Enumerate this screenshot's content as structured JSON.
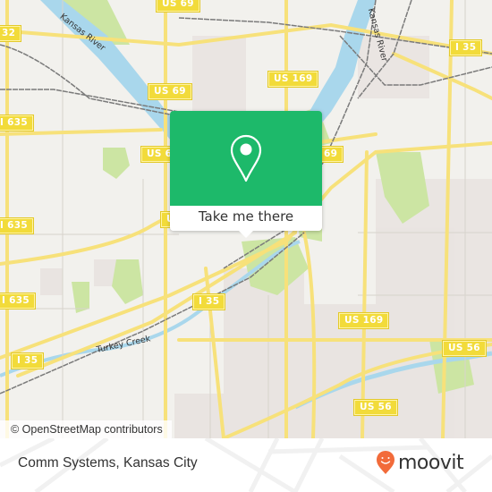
{
  "map": {
    "region": "Kansas City",
    "colors": {
      "background": "#f2f1ed",
      "water": "#a9d7ec",
      "park": "#cce5a3",
      "road": "#f7e17a",
      "rail": "#7a7a7a",
      "shield": "#f2db3a",
      "residential": "#e9e3e0"
    },
    "shields": [
      {
        "label": "US 69"
      },
      {
        "label": "32"
      },
      {
        "label": "US 69"
      },
      {
        "label": "I 635"
      },
      {
        "label": "US 169"
      },
      {
        "label": "I 35"
      },
      {
        "label": "US 69"
      },
      {
        "label": "69"
      },
      {
        "label": "U"
      },
      {
        "label": "I 635"
      },
      {
        "label": "I 635"
      },
      {
        "label": "I 35"
      },
      {
        "label": "I 35"
      },
      {
        "label": "US 169"
      },
      {
        "label": "US 56"
      },
      {
        "label": "US 56"
      }
    ],
    "water_labels": [
      {
        "label": "Kansas River"
      },
      {
        "label": "Kansas River"
      },
      {
        "label": "Turkey Creek"
      }
    ],
    "attribution": "© OpenStreetMap contributors"
  },
  "popup": {
    "icon": "map-pin-icon",
    "button_label": "Take me there",
    "accent_color": "#1db96a"
  },
  "footer": {
    "place_name": "Comm Systems, Kansas City",
    "brand": "moovit",
    "brand_icon": "moovit-smiley-pin-icon",
    "brand_color": "#f26b3a"
  }
}
